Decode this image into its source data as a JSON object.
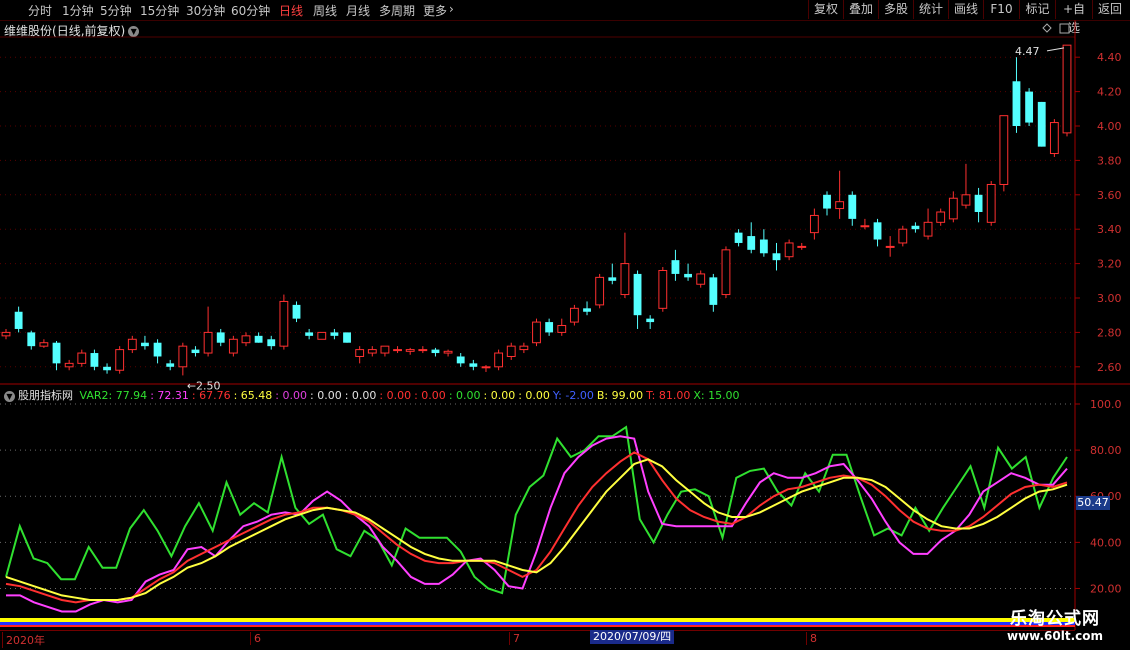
{
  "toolbar": {
    "periods": [
      "分时",
      "1分钟",
      "5分钟",
      "15分钟",
      "30分钟",
      "60分钟",
      "日线",
      "周线",
      "月线",
      "多周期",
      "更多"
    ],
    "active_period": "日线",
    "right_buttons": [
      "复权",
      "叠加",
      "多股",
      "统计",
      "画线",
      "F10",
      "标记",
      "+自选",
      "返回"
    ]
  },
  "stock": {
    "name": "维维股份",
    "mode": "(日线,前复权)",
    "high_marker": "4.47",
    "low_marker": "2.50"
  },
  "price_axis": [
    "4.40",
    "4.20",
    "4.00",
    "3.80",
    "3.60",
    "3.40",
    "3.20",
    "3.00",
    "2.80",
    "2.60"
  ],
  "indicator": {
    "name": "股朋指标网",
    "values": [
      {
        "text": "VAR2: 77.94",
        "color": "#30e030"
      },
      {
        "text": ": 72.31",
        "color": "#ff40ff"
      },
      {
        "text": ": 67.76",
        "color": "#ff3030"
      },
      {
        "text": ": 65.48",
        "color": "#ffff40"
      },
      {
        "text": ": 0.00",
        "color": "#e040e0"
      },
      {
        "text": ": 0.00",
        "color": "#e0e0e0"
      },
      {
        "text": ": 0.00",
        "color": "#e0e0e0"
      },
      {
        "text": ": 0.00",
        "color": "#ff3030"
      },
      {
        "text": ": 0.00",
        "color": "#ff3030"
      },
      {
        "text": ": 0.00",
        "color": "#30e030"
      },
      {
        "text": ": 0.00",
        "color": "#ffff40"
      },
      {
        "text": ": 0.00",
        "color": "#ffff40"
      },
      {
        "text": "Y: -2.00",
        "color": "#4060ff"
      },
      {
        "text": "B: 99.00",
        "color": "#ffff40"
      },
      {
        "text": "T: 81.00",
        "color": "#ff3030"
      },
      {
        "text": "X: 15.00",
        "color": "#30e030"
      }
    ],
    "axis": [
      "100.0",
      "80.00",
      "60.00",
      "40.00",
      "20.00"
    ],
    "last_value": "50.47"
  },
  "date_axis": {
    "labels": [
      "2020年",
      "6",
      "7",
      "8"
    ],
    "highlight": "2020/07/09/四"
  },
  "watermark": {
    "line1": "乐淘公式网",
    "line2": "www.60lt.com"
  },
  "chart_data": {
    "type": "candlestick",
    "candles": [
      [
        2.78,
        2.82,
        2.76,
        2.8
      ],
      [
        2.92,
        2.95,
        2.8,
        2.82
      ],
      [
        2.8,
        2.81,
        2.7,
        2.72
      ],
      [
        2.72,
        2.76,
        2.71,
        2.74
      ],
      [
        2.74,
        2.75,
        2.58,
        2.62
      ],
      [
        2.6,
        2.64,
        2.58,
        2.62
      ],
      [
        2.62,
        2.7,
        2.6,
        2.68
      ],
      [
        2.68,
        2.7,
        2.58,
        2.6
      ],
      [
        2.6,
        2.62,
        2.56,
        2.58
      ],
      [
        2.58,
        2.72,
        2.56,
        2.7
      ],
      [
        2.7,
        2.78,
        2.68,
        2.76
      ],
      [
        2.74,
        2.78,
        2.7,
        2.72
      ],
      [
        2.74,
        2.76,
        2.62,
        2.66
      ],
      [
        2.62,
        2.64,
        2.58,
        2.6
      ],
      [
        2.6,
        2.74,
        2.55,
        2.72
      ],
      [
        2.7,
        2.72,
        2.66,
        2.68
      ],
      [
        2.68,
        2.95,
        2.66,
        2.8
      ],
      [
        2.8,
        2.82,
        2.72,
        2.74
      ],
      [
        2.68,
        2.78,
        2.66,
        2.76
      ],
      [
        2.74,
        2.8,
        2.72,
        2.78
      ],
      [
        2.78,
        2.8,
        2.74,
        2.74
      ],
      [
        2.76,
        2.78,
        2.7,
        2.72
      ],
      [
        2.72,
        3.02,
        2.7,
        2.98
      ],
      [
        2.96,
        2.98,
        2.86,
        2.88
      ],
      [
        2.8,
        2.82,
        2.76,
        2.78
      ],
      [
        2.76,
        2.8,
        2.76,
        2.8
      ],
      [
        2.8,
        2.82,
        2.76,
        2.78
      ],
      [
        2.8,
        2.8,
        2.74,
        2.74
      ],
      [
        2.66,
        2.72,
        2.62,
        2.7
      ],
      [
        2.68,
        2.72,
        2.66,
        2.7
      ],
      [
        2.68,
        2.72,
        2.66,
        2.72
      ],
      [
        2.7,
        2.72,
        2.68,
        2.7
      ],
      [
        2.69,
        2.71,
        2.67,
        2.7
      ],
      [
        2.7,
        2.72,
        2.68,
        2.7
      ],
      [
        2.7,
        2.71,
        2.66,
        2.68
      ],
      [
        2.68,
        2.7,
        2.66,
        2.69
      ],
      [
        2.66,
        2.68,
        2.6,
        2.62
      ],
      [
        2.62,
        2.64,
        2.58,
        2.6
      ],
      [
        2.6,
        2.61,
        2.57,
        2.6
      ],
      [
        2.6,
        2.7,
        2.58,
        2.68
      ],
      [
        2.66,
        2.74,
        2.64,
        2.72
      ],
      [
        2.7,
        2.74,
        2.68,
        2.72
      ],
      [
        2.74,
        2.88,
        2.72,
        2.86
      ],
      [
        2.86,
        2.88,
        2.78,
        2.8
      ],
      [
        2.8,
        2.88,
        2.78,
        2.84
      ],
      [
        2.86,
        2.96,
        2.84,
        2.94
      ],
      [
        2.94,
        2.98,
        2.9,
        2.92
      ],
      [
        2.96,
        3.14,
        2.94,
        3.12
      ],
      [
        3.12,
        3.2,
        3.08,
        3.1
      ],
      [
        3.02,
        3.38,
        3.0,
        3.2
      ],
      [
        3.14,
        3.16,
        2.82,
        2.9
      ],
      [
        2.88,
        2.9,
        2.82,
        2.86
      ],
      [
        2.94,
        3.18,
        2.92,
        3.16
      ],
      [
        3.22,
        3.28,
        3.1,
        3.14
      ],
      [
        3.14,
        3.2,
        3.1,
        3.12
      ],
      [
        3.08,
        3.16,
        3.06,
        3.14
      ],
      [
        3.12,
        3.14,
        2.92,
        2.96
      ],
      [
        3.02,
        3.3,
        3.0,
        3.28
      ],
      [
        3.38,
        3.4,
        3.3,
        3.32
      ],
      [
        3.36,
        3.44,
        3.26,
        3.28
      ],
      [
        3.34,
        3.4,
        3.24,
        3.26
      ],
      [
        3.26,
        3.32,
        3.16,
        3.22
      ],
      [
        3.24,
        3.34,
        3.22,
        3.32
      ],
      [
        3.3,
        3.32,
        3.28,
        3.3
      ],
      [
        3.38,
        3.52,
        3.34,
        3.48
      ],
      [
        3.6,
        3.62,
        3.48,
        3.52
      ],
      [
        3.52,
        3.74,
        3.46,
        3.56
      ],
      [
        3.6,
        3.62,
        3.42,
        3.46
      ],
      [
        3.42,
        3.46,
        3.4,
        3.42
      ],
      [
        3.44,
        3.46,
        3.3,
        3.34
      ],
      [
        3.3,
        3.36,
        3.24,
        3.3
      ],
      [
        3.32,
        3.42,
        3.3,
        3.4
      ],
      [
        3.42,
        3.44,
        3.38,
        3.4
      ],
      [
        3.36,
        3.52,
        3.34,
        3.44
      ],
      [
        3.44,
        3.52,
        3.42,
        3.5
      ],
      [
        3.46,
        3.62,
        3.44,
        3.58
      ],
      [
        3.54,
        3.78,
        3.52,
        3.6
      ],
      [
        3.6,
        3.64,
        3.44,
        3.5
      ],
      [
        3.44,
        3.68,
        3.42,
        3.66
      ],
      [
        3.66,
        4.06,
        3.62,
        4.06
      ],
      [
        4.26,
        4.4,
        3.96,
        4.0
      ],
      [
        4.2,
        4.22,
        4.0,
        4.02
      ],
      [
        4.14,
        4.14,
        3.88,
        3.88
      ],
      [
        3.84,
        4.04,
        3.82,
        4.02
      ],
      [
        3.96,
        4.46,
        3.94,
        4.47
      ]
    ],
    "indicator_series": [
      {
        "name": "VAR2",
        "color": "#30e030",
        "values": [
          25,
          47,
          33,
          31,
          24,
          24,
          38,
          29,
          29,
          46,
          54,
          45,
          34,
          47,
          57,
          45,
          66,
          52,
          57,
          53,
          77,
          55,
          48,
          52,
          37,
          34,
          45,
          41,
          30,
          46,
          42,
          42,
          42,
          36,
          25,
          20,
          18,
          52,
          64,
          69,
          85,
          77,
          80,
          86,
          86,
          90,
          50,
          40,
          52,
          62,
          63,
          60,
          42,
          68,
          71,
          72,
          62,
          56,
          70,
          62,
          78,
          78,
          60,
          43,
          46,
          43,
          55,
          45,
          55,
          64,
          73,
          55,
          81,
          72,
          77,
          55,
          68,
          77
        ]
      },
      {
        "name": "",
        "color": "#ff40ff",
        "values": [
          17,
          17,
          14,
          12,
          10,
          10,
          13,
          15,
          14,
          15,
          23,
          26,
          28,
          37,
          38,
          34,
          41,
          47,
          49,
          52,
          53,
          52,
          58,
          62,
          58,
          52,
          47,
          38,
          32,
          25,
          22,
          22,
          26,
          32,
          33,
          28,
          21,
          20,
          36,
          55,
          70,
          77,
          82,
          85,
          86,
          85,
          62,
          48,
          47,
          47,
          47,
          47,
          47,
          57,
          66,
          70,
          68,
          68,
          70,
          73,
          74,
          67,
          59,
          49,
          40,
          35,
          35,
          41,
          45,
          52,
          62,
          66,
          70,
          68,
          65,
          65,
          72
        ]
      },
      {
        "name": "",
        "color": "#ff3030",
        "values": [
          22,
          21,
          19,
          17,
          15,
          14,
          15,
          15,
          15,
          16,
          20,
          24,
          27,
          32,
          35,
          38,
          41,
          44,
          47,
          50,
          52,
          53,
          55,
          55,
          54,
          52,
          49,
          44,
          39,
          35,
          32,
          31,
          31,
          32,
          32,
          31,
          28,
          25,
          28,
          36,
          46,
          56,
          64,
          70,
          75,
          79,
          76,
          67,
          59,
          54,
          51,
          49,
          48,
          51,
          56,
          60,
          63,
          64,
          66,
          68,
          69,
          68,
          65,
          60,
          54,
          49,
          46,
          45,
          45,
          47,
          51,
          56,
          61,
          64,
          65,
          64,
          66
        ]
      },
      {
        "name": "",
        "color": "#ffff40",
        "values": [
          25,
          23,
          21,
          19,
          17,
          16,
          15,
          15,
          15,
          16,
          18,
          22,
          25,
          29,
          31,
          34,
          38,
          41,
          44,
          47,
          50,
          52,
          54,
          55,
          54,
          53,
          50,
          46,
          42,
          38,
          35,
          33,
          32,
          32,
          32,
          32,
          30,
          28,
          27,
          31,
          38,
          46,
          54,
          62,
          68,
          74,
          76,
          73,
          67,
          62,
          57,
          53,
          51,
          51,
          53,
          56,
          59,
          62,
          64,
          66,
          68,
          68,
          67,
          64,
          59,
          54,
          50,
          47,
          46,
          46,
          48,
          51,
          55,
          59,
          62,
          63,
          65
        ]
      }
    ],
    "indicator_ylim": [
      15,
      100
    ],
    "price_ylim": [
      2.5,
      4.5
    ]
  }
}
